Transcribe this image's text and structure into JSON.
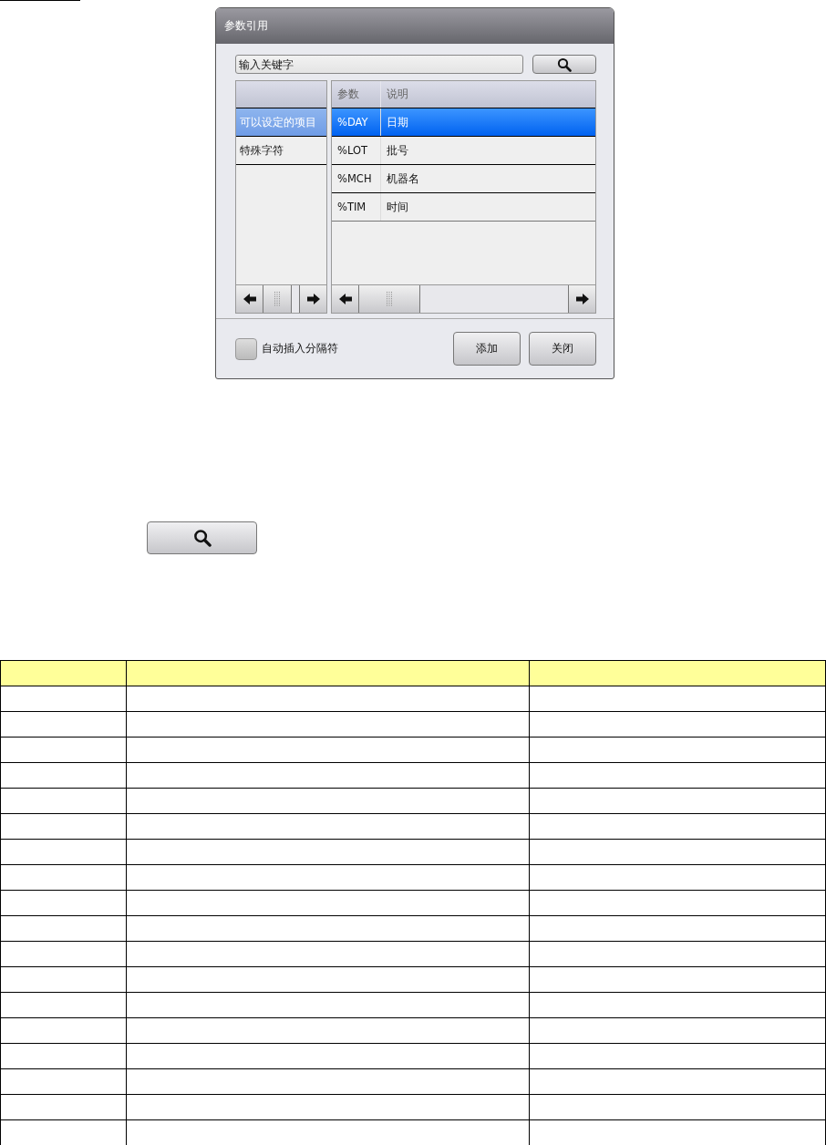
{
  "dialog": {
    "title": "参数引用",
    "search": {
      "placeholder": "输入关键字"
    },
    "categories": [
      {
        "label": "可以设定的项目",
        "selected": true
      },
      {
        "label": "特殊字符",
        "selected": false
      }
    ],
    "table": {
      "columns": [
        "参数",
        "说明"
      ],
      "rows": [
        {
          "cells": [
            "%DAY",
            "日期"
          ],
          "selected": true
        },
        {
          "cells": [
            "%LOT",
            "批号"
          ],
          "selected": false
        },
        {
          "cells": [
            "%MCH",
            "机器名"
          ],
          "selected": false
        },
        {
          "cells": [
            "%TIM",
            "时间"
          ],
          "selected": false
        }
      ]
    },
    "auto_separator": {
      "label": "自动插入分隔符",
      "checked": false
    },
    "buttons": [
      "添加",
      "关闭"
    ]
  }
}
